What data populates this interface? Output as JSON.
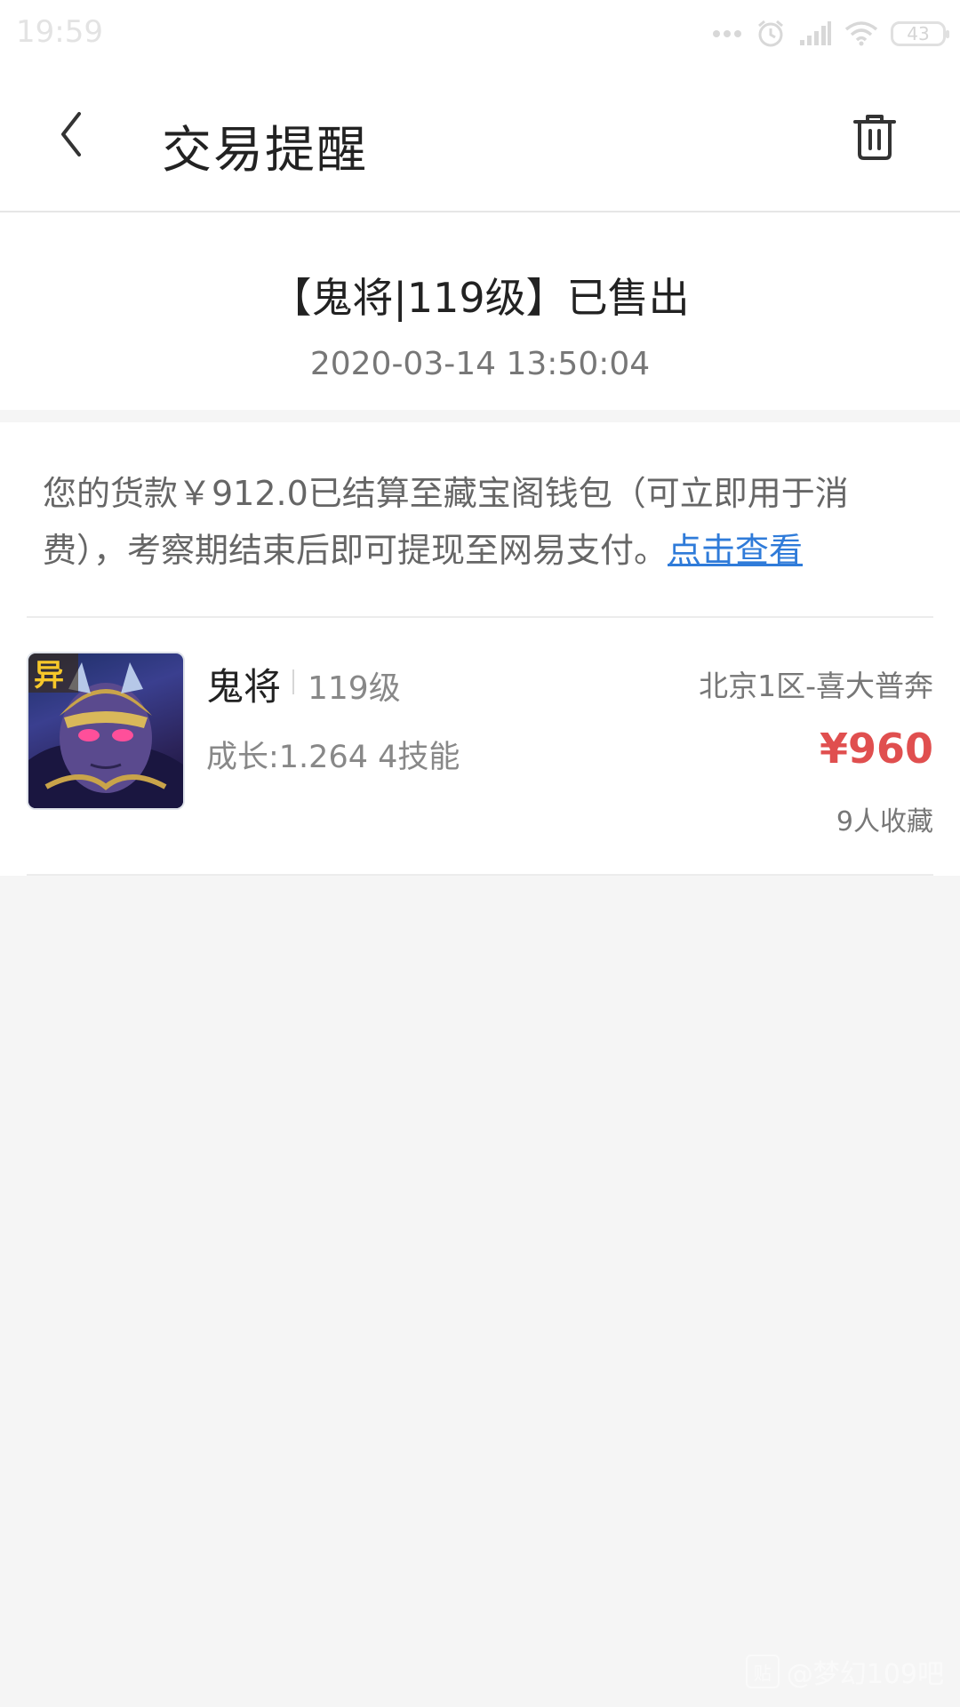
{
  "status_bar": {
    "time": "19:59",
    "battery": "43",
    "icons": [
      "more-dots-icon",
      "alarm-icon",
      "signal-icon",
      "wifi-icon",
      "battery-icon"
    ]
  },
  "header": {
    "title": "交易提醒",
    "back_icon": "chevron-left-icon",
    "delete_icon": "trash-icon"
  },
  "notice": {
    "title": "【鬼将|119级】已售出",
    "time": "2020-03-14 13:50:04"
  },
  "detail": {
    "text": "您的货款￥912.0已结算至藏宝阁钱包（可立即用于消费），考察期结束后即可提现至网易支付。",
    "link": "点击查看"
  },
  "item": {
    "badge": "异",
    "name": "鬼将",
    "level": "119级",
    "growth": "成长:1.264 4技能",
    "server": "北京1区-喜大普奔",
    "price": "¥960",
    "favorites": "9人收藏"
  },
  "watermark": {
    "badge": "贴",
    "text": "@梦幻109吧"
  },
  "colors": {
    "price": "#e04f4f",
    "link": "#2f7bd9",
    "background": "#f5f5f5"
  }
}
